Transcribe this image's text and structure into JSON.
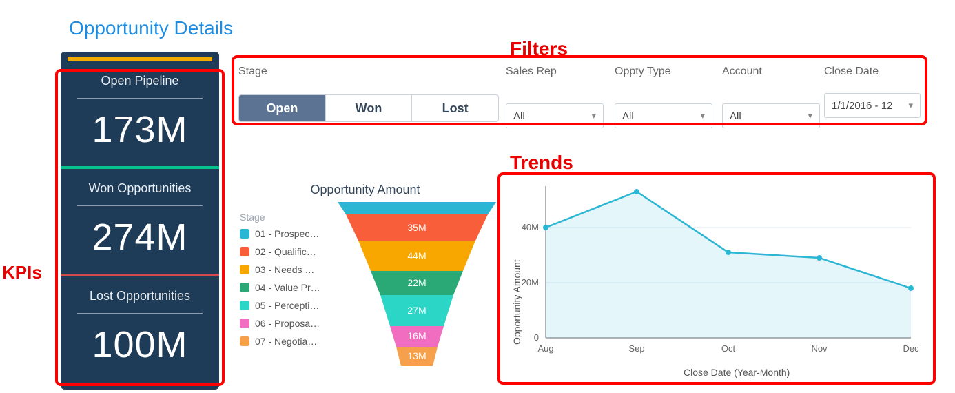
{
  "page": {
    "title": "Opportunity Details"
  },
  "annotations": {
    "kpis": "KPIs",
    "filters": "Filters",
    "trends": "Trends"
  },
  "kpis": [
    {
      "label": "Open Pipeline",
      "value": "173M"
    },
    {
      "label": "Won Opportunities",
      "value": "274M"
    },
    {
      "label": "Lost Opportunities",
      "value": "100M"
    }
  ],
  "filters": {
    "stage": {
      "label": "Stage",
      "options": [
        "Open",
        "Won",
        "Lost"
      ],
      "selected": "Open"
    },
    "rep": {
      "label": "Sales Rep",
      "value": "All"
    },
    "type": {
      "label": "Oppty Type",
      "value": "All"
    },
    "account": {
      "label": "Account",
      "value": "All"
    },
    "close": {
      "label": "Close Date",
      "value": "1/1/2016 - 12"
    }
  },
  "funnel": {
    "title": "Opportunity Amount",
    "legend_header": "Stage",
    "legend": [
      {
        "label": "01 - Prospec…",
        "color": "#2bb6d3"
      },
      {
        "label": "02 - Qualific…",
        "color": "#f85e3a"
      },
      {
        "label": "03 - Needs …",
        "color": "#f7a700"
      },
      {
        "label": "04 - Value Pr…",
        "color": "#2aa876"
      },
      {
        "label": "05 - Percepti…",
        "color": "#2bd6c6"
      },
      {
        "label": "06 - Proposa…",
        "color": "#f06dc0"
      },
      {
        "label": "07 - Negotia…",
        "color": "#f7a04b"
      }
    ]
  },
  "trend": {
    "ylabel": "Opportunity Amount",
    "xlabel": "Close Date (Year-Month)",
    "yticks": [
      "0",
      "20M",
      "40M"
    ]
  },
  "chart_data": [
    {
      "type": "funnel",
      "title": "Opportunity Amount",
      "categories": [
        "01 - Prospecting",
        "02 - Qualification",
        "03 - Needs Analysis",
        "04 - Value Proposition",
        "05 - Perception Analysis",
        "06 - Proposal",
        "07 - Negotiation"
      ],
      "values": [
        10,
        35,
        44,
        22,
        27,
        16,
        13
      ],
      "value_labels": [
        "",
        "35M",
        "44M",
        "22M",
        "27M",
        "16M",
        "13M"
      ],
      "unit": "M"
    },
    {
      "type": "line",
      "title": "Opportunity Amount Trend",
      "x": [
        "Aug",
        "Sep",
        "Oct",
        "Nov",
        "Dec"
      ],
      "y": [
        40,
        53,
        31,
        29,
        18
      ],
      "xlabel": "Close Date (Year-Month)",
      "ylabel": "Opportunity Amount",
      "ylim": [
        0,
        55
      ],
      "yticks": [
        0,
        20,
        40
      ],
      "unit": "M"
    }
  ]
}
